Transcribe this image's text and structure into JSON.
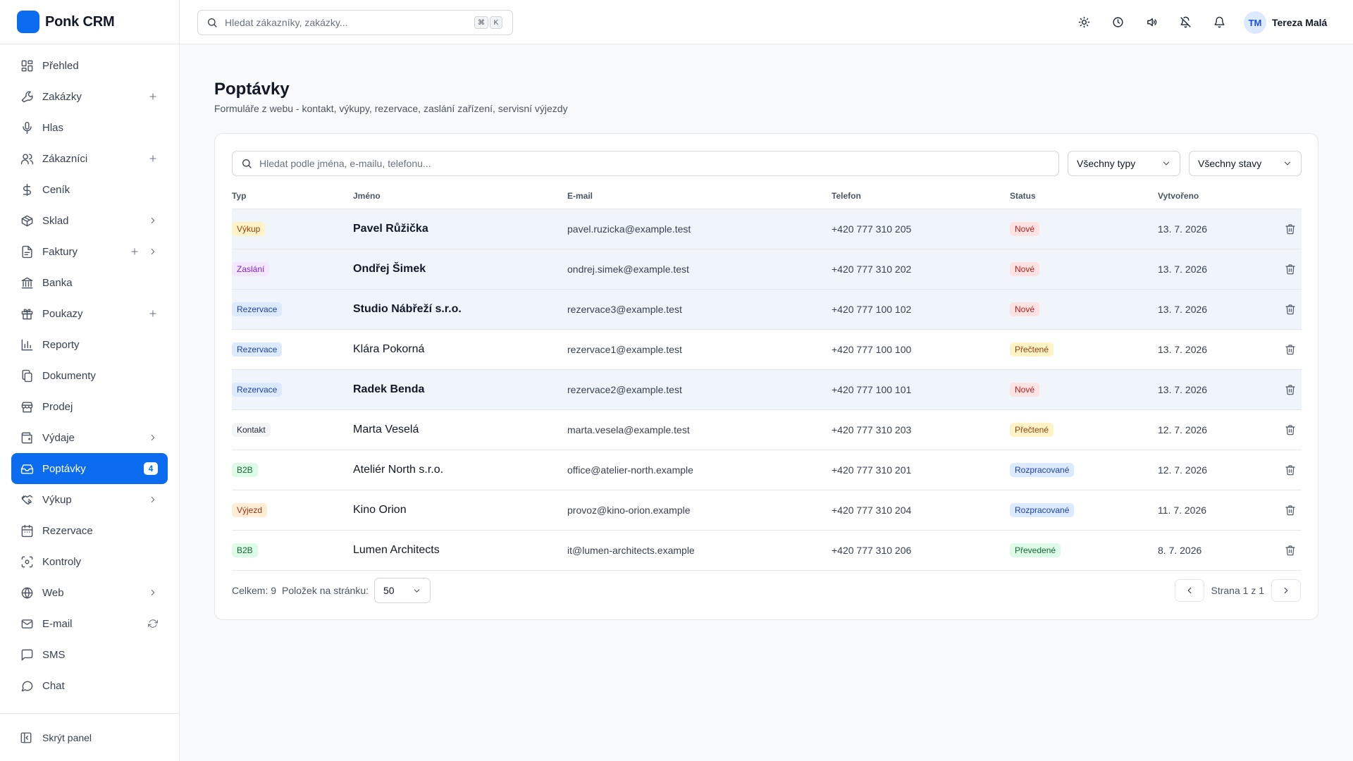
{
  "app": {
    "name": "Ponk CRM",
    "accent": "#0b6cf0"
  },
  "sidebar": {
    "items": [
      {
        "label": "Přehled",
        "icon": "dashboard-icon",
        "plus": false,
        "chevron": false
      },
      {
        "label": "Zakázky",
        "icon": "wrench-icon",
        "plus": true,
        "chevron": false
      },
      {
        "label": "Hlas",
        "icon": "microphone-icon",
        "plus": false,
        "chevron": false
      },
      {
        "label": "Zákazníci",
        "icon": "users-icon",
        "plus": true,
        "chevron": false
      },
      {
        "label": "Ceník",
        "icon": "dollar-icon",
        "plus": false,
        "chevron": false
      },
      {
        "label": "Sklad",
        "icon": "package-icon",
        "plus": false,
        "chevron": true
      },
      {
        "label": "Faktury",
        "icon": "invoice-icon",
        "plus": true,
        "chevron": true
      },
      {
        "label": "Banka",
        "icon": "bank-icon",
        "plus": false,
        "chevron": false
      },
      {
        "label": "Poukazy",
        "icon": "gift-icon",
        "plus": true,
        "chevron": false
      },
      {
        "label": "Reporty",
        "icon": "chart-icon",
        "plus": false,
        "chevron": false
      },
      {
        "label": "Dokumenty",
        "icon": "documents-icon",
        "plus": false,
        "chevron": false
      },
      {
        "label": "Prodej",
        "icon": "store-icon",
        "plus": false,
        "chevron": false
      },
      {
        "label": "Výdaje",
        "icon": "wallet-icon",
        "plus": false,
        "chevron": true
      },
      {
        "label": "Poptávky",
        "icon": "inbox-icon",
        "plus": false,
        "chevron": false,
        "active": true,
        "badge": "4"
      },
      {
        "label": "Výkup",
        "icon": "handshake-icon",
        "plus": false,
        "chevron": true
      },
      {
        "label": "Rezervace",
        "icon": "calendar-icon",
        "plus": false,
        "chevron": false
      },
      {
        "label": "Kontroly",
        "icon": "scan-icon",
        "plus": false,
        "chevron": false
      },
      {
        "label": "Web",
        "icon": "globe-icon",
        "plus": false,
        "chevron": true
      },
      {
        "label": "E-mail",
        "icon": "mail-icon",
        "plus": false,
        "chevron": false,
        "refresh": true
      },
      {
        "label": "SMS",
        "icon": "message-icon",
        "plus": false,
        "chevron": false
      },
      {
        "label": "Chat",
        "icon": "chat-icon",
        "plus": false,
        "chevron": false
      }
    ],
    "footer_label": "Skrýt panel"
  },
  "topbar": {
    "search_placeholder": "Hledat zákazníky, zakázky...",
    "shortcut_keys": [
      "⌘",
      "K"
    ],
    "icons": [
      "sun-icon",
      "clock-icon",
      "speaker-icon",
      "bell-off-icon",
      "bell-icon"
    ],
    "user_initials": "TM",
    "user_name": "Tereza Malá"
  },
  "page": {
    "title": "Poptávky",
    "subtitle": "Formuláře z webu - kontakt, výkupy, rezervace, zaslání zařízení, servisní výjezdy"
  },
  "filters": {
    "search_placeholder": "Hledat podle jména, e-mailu, telefonu...",
    "type_select": "Všechny typy",
    "status_select": "Všechny stavy"
  },
  "table": {
    "columns": [
      "Typ",
      "Jméno",
      "E-mail",
      "Telefon",
      "Status",
      "Vytvořeno"
    ],
    "rows": [
      {
        "type": "Výkup",
        "type_bg": "#fef3c7",
        "type_fg": "#92400e",
        "name": "Pavel Růžička",
        "email": "pavel.ruzicka@example.test",
        "phone": "+420 777 310 205",
        "status": "Nové",
        "status_bg": "#fee2e2",
        "status_fg": "#b91c1c",
        "created": "13. 7. 2026",
        "unread": true
      },
      {
        "type": "Zaslání",
        "type_bg": "#f3e8ff",
        "type_fg": "#7e22ce",
        "name": "Ondřej Šimek",
        "email": "ondrej.simek@example.test",
        "phone": "+420 777 310 202",
        "status": "Nové",
        "status_bg": "#fee2e2",
        "status_fg": "#b91c1c",
        "created": "13. 7. 2026",
        "unread": true
      },
      {
        "type": "Rezervace",
        "type_bg": "#dbeafe",
        "type_fg": "#1e40af",
        "name": "Studio Nábřeží s.r.o.",
        "email": "rezervace3@example.test",
        "phone": "+420 777 100 102",
        "status": "Nové",
        "status_bg": "#fee2e2",
        "status_fg": "#b91c1c",
        "created": "13. 7. 2026",
        "unread": true
      },
      {
        "type": "Rezervace",
        "type_bg": "#dbeafe",
        "type_fg": "#1e40af",
        "name": "Klára Pokorná",
        "email": "rezervace1@example.test",
        "phone": "+420 777 100 100",
        "status": "Přečtené",
        "status_bg": "#fef3c7",
        "status_fg": "#92400e",
        "created": "13. 7. 2026",
        "unread": false
      },
      {
        "type": "Rezervace",
        "type_bg": "#dbeafe",
        "type_fg": "#1e40af",
        "name": "Radek Benda",
        "email": "rezervace2@example.test",
        "phone": "+420 777 100 101",
        "status": "Nové",
        "status_bg": "#fee2e2",
        "status_fg": "#b91c1c",
        "created": "13. 7. 2026",
        "unread": true
      },
      {
        "type": "Kontakt",
        "type_bg": "#f3f4f6",
        "type_fg": "#1f2937",
        "name": "Marta Veselá",
        "email": "marta.vesela@example.test",
        "phone": "+420 777 310 203",
        "status": "Přečtené",
        "status_bg": "#fef3c7",
        "status_fg": "#92400e",
        "created": "12. 7. 2026",
        "unread": false
      },
      {
        "type": "B2B",
        "type_bg": "#dcfce7",
        "type_fg": "#166534",
        "name": "Ateliér North s.r.o.",
        "email": "office@atelier-north.example",
        "phone": "+420 777 310 201",
        "status": "Rozpracované",
        "status_bg": "#dbeafe",
        "status_fg": "#1e40af",
        "created": "12. 7. 2026",
        "unread": false
      },
      {
        "type": "Výjezd",
        "type_bg": "#ffedd5",
        "type_fg": "#9a3412",
        "name": "Kino Orion",
        "email": "provoz@kino-orion.example",
        "phone": "+420 777 310 204",
        "status": "Rozpracované",
        "status_bg": "#dbeafe",
        "status_fg": "#1e40af",
        "created": "11. 7. 2026",
        "unread": false
      },
      {
        "type": "B2B",
        "type_bg": "#dcfce7",
        "type_fg": "#166534",
        "name": "Lumen Architects",
        "email": "it@lumen-architects.example",
        "phone": "+420 777 310 206",
        "status": "Převedené",
        "status_bg": "#dcfce7",
        "status_fg": "#166534",
        "created": "8. 7. 2026",
        "unread": false
      }
    ]
  },
  "footer": {
    "total": "Celkem: 9",
    "per_page_label": "Položek na stránku:",
    "per_page_value": "50",
    "page_text": "Strana 1 z 1"
  }
}
